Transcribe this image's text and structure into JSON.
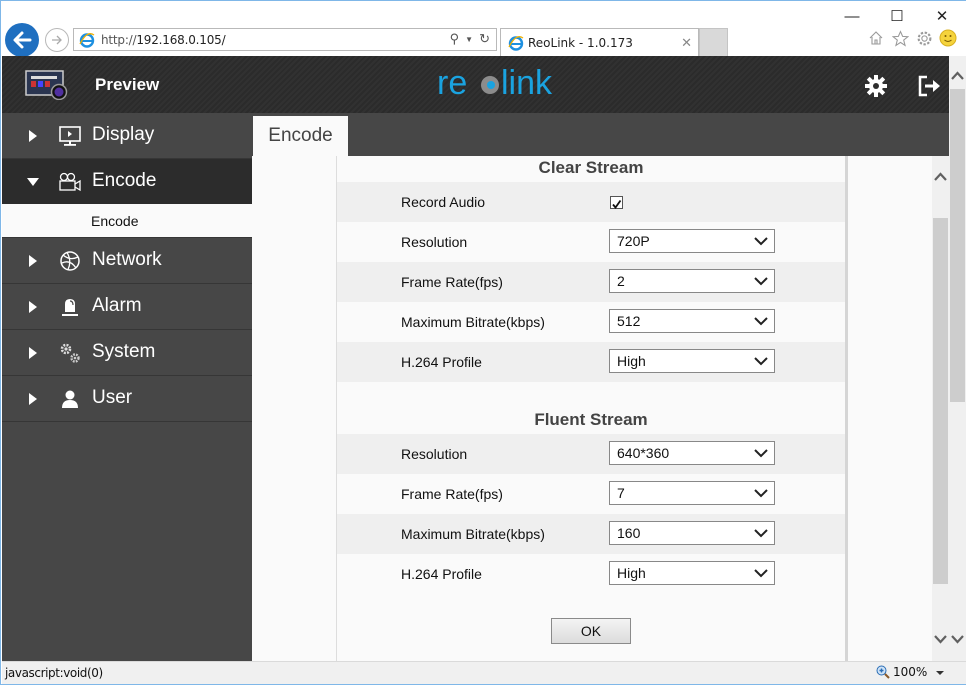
{
  "browser": {
    "window_controls": {
      "minimize": "—",
      "maximize": "☐",
      "close": "✕"
    },
    "address_bar": {
      "url_prefix": "http://",
      "url_host": "192.168.0.105/"
    },
    "tab": {
      "title": "ReoLink - 1.0.173",
      "close": "✕"
    },
    "toolbar_icons": [
      "home-icon",
      "star-icon",
      "gear-icon",
      "smiley-icon"
    ]
  },
  "header": {
    "preview_label": "Preview",
    "logo_text_left": "re",
    "logo_text_right": "link",
    "colors": {
      "logo_blue": "#1aa3e0",
      "logo_gray": "#8c8c8c"
    }
  },
  "sidebar": {
    "items": [
      {
        "label": "Display",
        "icon": "monitor-icon",
        "expanded": false
      },
      {
        "label": "Encode",
        "icon": "video-camera-icon",
        "expanded": true,
        "subitems": [
          "Encode"
        ]
      },
      {
        "label": "Network",
        "icon": "globe-icon",
        "expanded": false
      },
      {
        "label": "Alarm",
        "icon": "siren-icon",
        "expanded": false
      },
      {
        "label": "System",
        "icon": "gears-icon",
        "expanded": false
      },
      {
        "label": "User",
        "icon": "user-icon",
        "expanded": false
      }
    ]
  },
  "main": {
    "tab_label": "Encode",
    "clear_stream": {
      "title": "Clear Stream",
      "record_audio_label": "Record Audio",
      "record_audio_checked": true,
      "rows": [
        {
          "label": "Resolution",
          "value": "720P"
        },
        {
          "label": "Frame Rate(fps)",
          "value": "2"
        },
        {
          "label": "Maximum Bitrate(kbps)",
          "value": "512"
        },
        {
          "label": "H.264 Profile",
          "value": "High"
        }
      ]
    },
    "fluent_stream": {
      "title": "Fluent Stream",
      "rows": [
        {
          "label": "Resolution",
          "value": "640*360"
        },
        {
          "label": "Frame Rate(fps)",
          "value": "7"
        },
        {
          "label": "Maximum Bitrate(kbps)",
          "value": "160"
        },
        {
          "label": "H.264 Profile",
          "value": "High"
        }
      ]
    },
    "ok_label": "OK"
  },
  "statusbar": {
    "text": "javascript:void(0)",
    "zoom": "100%"
  }
}
